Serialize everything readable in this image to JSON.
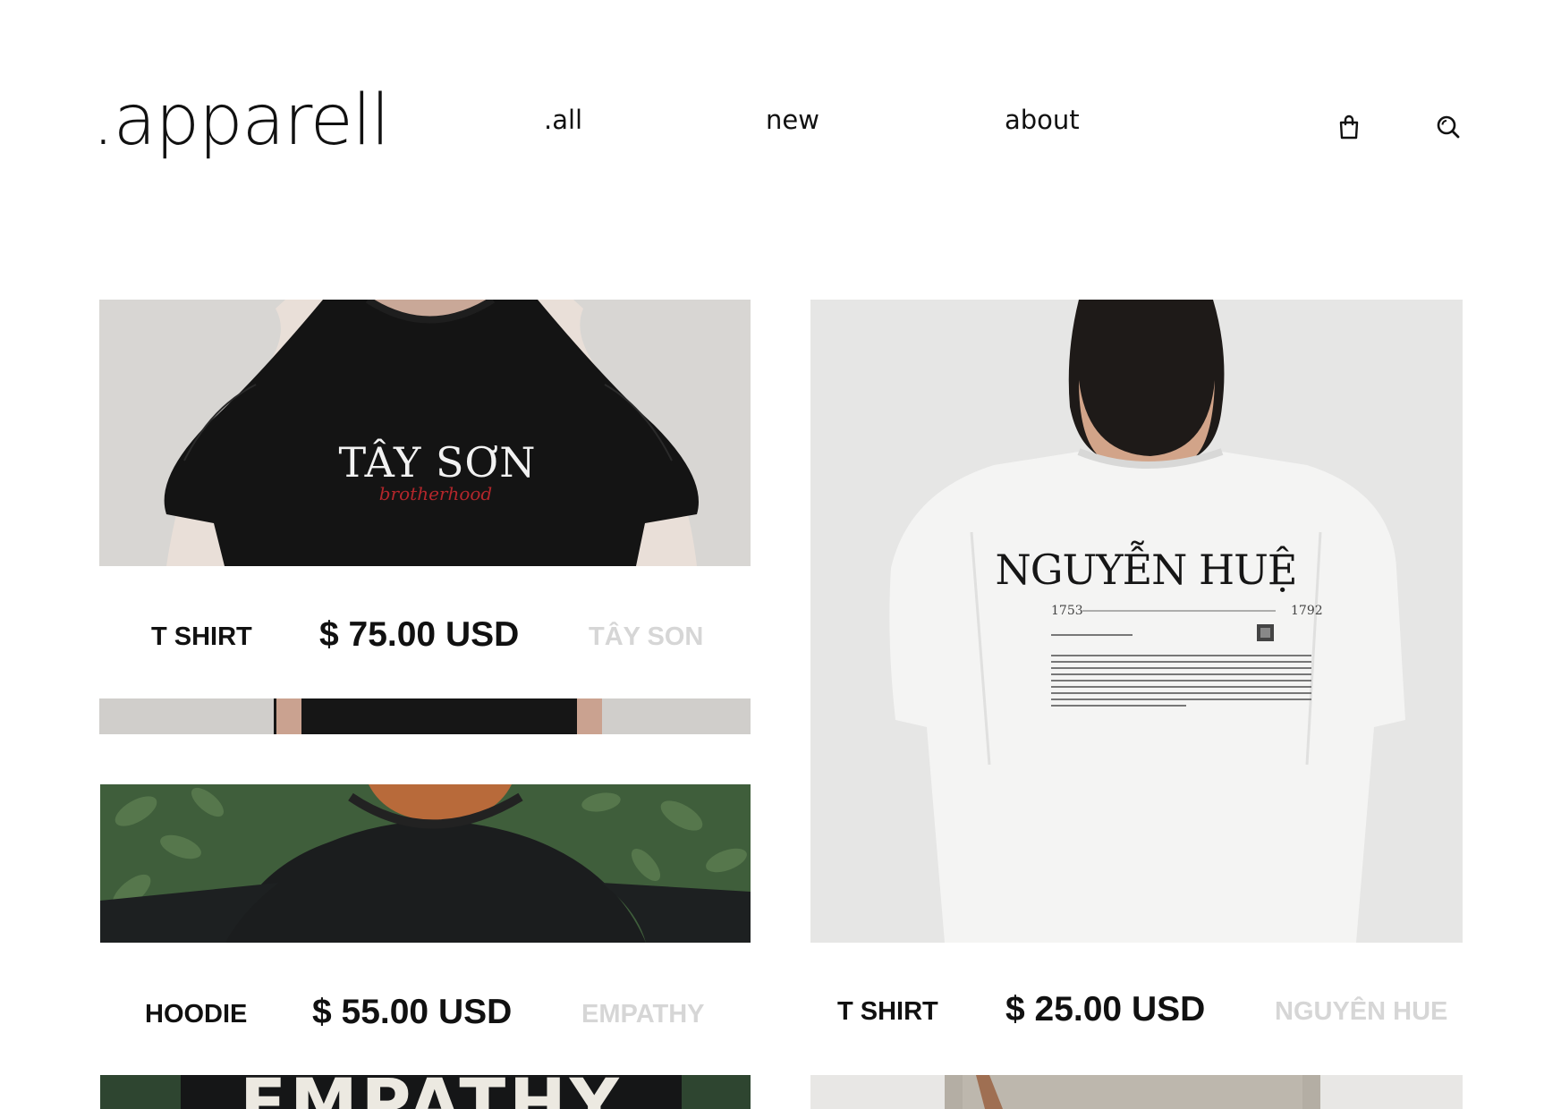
{
  "header": {
    "logo": ".apparell",
    "nav": [
      ".all",
      "new",
      "about"
    ],
    "icons": [
      "shopping-bag-icon",
      "search-icon"
    ]
  },
  "products": [
    {
      "type": "T SHIRT",
      "price": "$ 75.00 USD",
      "name": "TÂY SON",
      "print_title": "TÂY SƠN",
      "print_subtitle": "brotherhood"
    },
    {
      "type": "HOODIE",
      "price": "$ 55.00 USD",
      "name": "EMPATHY",
      "print_title": "EMPATHY"
    },
    {
      "type": "T SHIRT",
      "price": "$ 25.00 USD",
      "name": "NGUYÊN HUE",
      "print_title": "NGUYỄN HUỆ",
      "print_year_start": "1753",
      "print_year_end": "1792"
    }
  ],
  "colors": {
    "text": "#111111",
    "muted_name": "#d6d6d6",
    "accent_red": "#b3262b"
  }
}
